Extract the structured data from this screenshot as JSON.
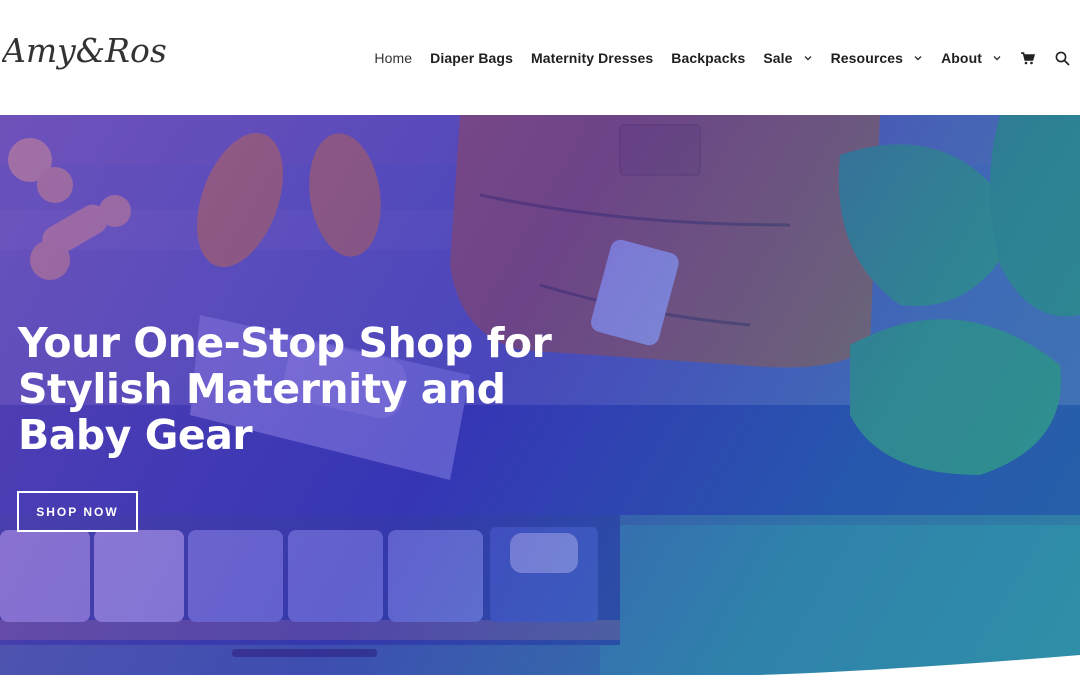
{
  "brand": {
    "logo_text": "Amy&Rose"
  },
  "nav": {
    "items": [
      {
        "label": "Home",
        "active": true,
        "dropdown": false
      },
      {
        "label": "Diaper Bags",
        "active": false,
        "dropdown": false
      },
      {
        "label": "Maternity Dresses",
        "active": false,
        "dropdown": false
      },
      {
        "label": "Backpacks",
        "active": false,
        "dropdown": false
      },
      {
        "label": "Sale",
        "active": false,
        "dropdown": true
      },
      {
        "label": "Resources",
        "active": false,
        "dropdown": true
      },
      {
        "label": "About",
        "active": false,
        "dropdown": true
      }
    ],
    "icons": [
      "cart-icon",
      "search-icon"
    ]
  },
  "hero": {
    "title_line1": "Your One-Stop Shop for",
    "title_line2": "Stylish Maternity and",
    "title_line3": "Baby Gear",
    "cta_label": "SHOP NOW"
  },
  "colors": {
    "overlay_start": "#7846be",
    "overlay_mid": "#3c32be",
    "overlay_end": "#1e96aa",
    "text_dark": "#1f1f1f",
    "white": "#ffffff"
  }
}
